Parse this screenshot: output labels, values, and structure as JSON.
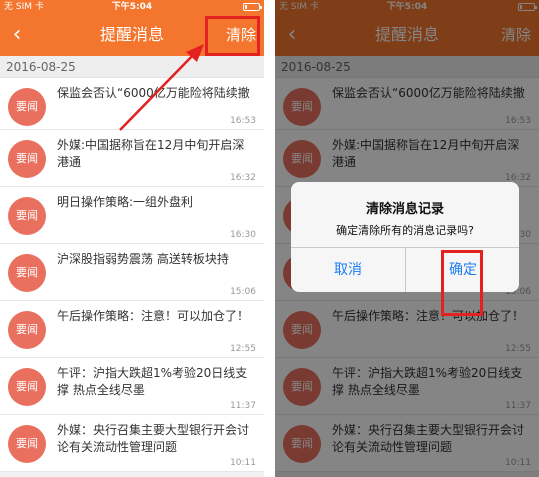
{
  "status": {
    "carrier": "无 SIM 卡",
    "time": "下午5:04"
  },
  "nav": {
    "title": "提醒消息",
    "clear": "清除"
  },
  "date": "2016-08-25",
  "badge": "要闻",
  "items": [
    {
      "text": "保监会否认“6000亿万能险将陆续撤",
      "time": "16:53"
    },
    {
      "text": "外媒:中国据称旨在12月中旬开启深港通",
      "time": "16:32"
    },
    {
      "text": "明日操作策略:一组外盘利",
      "time": "16:30"
    },
    {
      "text": "沪深股指弱势震荡 高送转板块持",
      "time": "15:06"
    },
    {
      "text": "午后操作策略：注意！可以加仓了！",
      "time": "12:55"
    },
    {
      "text": "午评：沪指大跌超1%考验20日线支撑 热点全线尽墨",
      "time": "11:37"
    },
    {
      "text": "外媒：央行召集主要大型银行开会讨论有关流动性管理问题",
      "time": "10:11"
    }
  ],
  "dialog": {
    "title": "清除消息记录",
    "message": "确定清除所有的消息记录吗?",
    "cancel": "取消",
    "ok": "确定"
  },
  "colors": {
    "accent": "#f4762e",
    "badge": "#e9705e",
    "highlight": "#e32121",
    "link": "#1a7ef5"
  }
}
